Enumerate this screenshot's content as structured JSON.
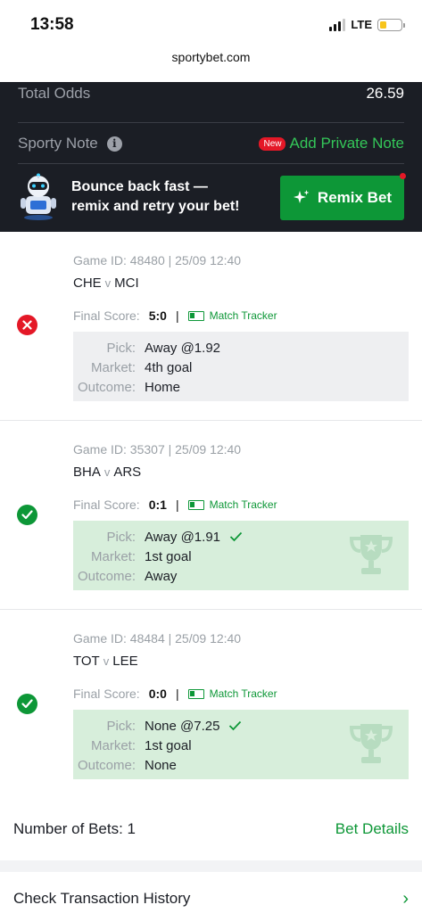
{
  "status_bar": {
    "time": "13:58",
    "network": "LTE",
    "battery_level": 0.34
  },
  "browser": {
    "url": "sportybet.com"
  },
  "summary": {
    "total_odds_label": "Total Odds",
    "total_odds_value": "26.59",
    "note_label": "Sporty Note",
    "new_badge": "New",
    "add_note_label": "Add Private Note"
  },
  "remix": {
    "line1": "Bounce back fast —",
    "line2": "remix and retry your bet!",
    "button_label": "Remix Bet"
  },
  "games": [
    {
      "meta": "Game ID: 48480 | 25/09 12:40",
      "home": "CHE",
      "vs": "v",
      "away": "MCI",
      "score_label": "Final Score:",
      "score": "5:0",
      "separator": "|",
      "tracker": "Match Tracker",
      "status": "lost",
      "pick_label": "Pick:",
      "pick": "Away @1.92",
      "market_label": "Market:",
      "market": "4th goal",
      "outcome_label": "Outcome:",
      "outcome": "Home"
    },
    {
      "meta": "Game ID: 35307 | 25/09 12:40",
      "home": "BHA",
      "vs": "v",
      "away": "ARS",
      "score_label": "Final Score:",
      "score": "0:1",
      "separator": "|",
      "tracker": "Match Tracker",
      "status": "won",
      "pick_label": "Pick:",
      "pick": "Away @1.91",
      "market_label": "Market:",
      "market": "1st goal",
      "outcome_label": "Outcome:",
      "outcome": "Away"
    },
    {
      "meta": "Game ID: 48484 | 25/09 12:40",
      "home": "TOT",
      "vs": "v",
      "away": "LEE",
      "score_label": "Final Score:",
      "score": "0:0",
      "separator": "|",
      "tracker": "Match Tracker",
      "status": "won",
      "pick_label": "Pick:",
      "pick": "None @7.25",
      "market_label": "Market:",
      "market": "1st goal",
      "outcome_label": "Outcome:",
      "outcome": "None"
    }
  ],
  "footer": {
    "bets_count": "Number of Bets: 1",
    "details_link": "Bet Details",
    "history_label": "Check Transaction History",
    "history_chevron": "›"
  },
  "colors": {
    "accent_green": "#0d9737",
    "lost_red": "#e41827",
    "dark_bg": "#1b1e25",
    "won_bg": "#d7eedb"
  }
}
